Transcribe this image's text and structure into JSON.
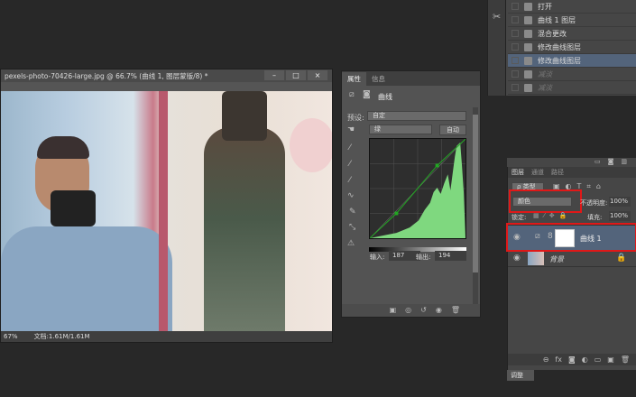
{
  "history": {
    "items": [
      {
        "label": "打开",
        "state": "normal"
      },
      {
        "label": "曲线 1 图层",
        "state": "normal"
      },
      {
        "label": "混合更改",
        "state": "normal"
      },
      {
        "label": "修改曲线图层",
        "state": "normal"
      },
      {
        "label": "修改曲线图层",
        "state": "selected"
      },
      {
        "label": "减淡",
        "state": "dim"
      },
      {
        "label": "减淡",
        "state": "dim"
      }
    ]
  },
  "document": {
    "title": "pexels-photo-70426-large.jpg @ 66.7% (曲线 1, 图层蒙版/8) *",
    "zoom": "67%",
    "doc_size": "文档:1.61M/1.61M",
    "minimize": "–",
    "maximize": "□",
    "close": "×"
  },
  "properties": {
    "tabs": [
      "属性",
      "信息"
    ],
    "title": "曲线",
    "preset_label": "预设:",
    "preset_value": "自定",
    "channel_value": "绿",
    "auto_label": "自动",
    "input_label": "输入:",
    "input_value": "187",
    "output_label": "输出:",
    "output_value": "194",
    "curve_color": "#7fd87f"
  },
  "layers": {
    "tabs": [
      "图层",
      "通道",
      "路径"
    ],
    "filter_label": "ρ 类型",
    "blend_mode": "颜色",
    "opacity_label": "不透明度:",
    "opacity_value": "100%",
    "lock_label": "锁定:",
    "fill_label": "填充:",
    "fill_value": "100%",
    "items": [
      {
        "name": "曲线 1",
        "selected": true
      },
      {
        "name": "背景",
        "locked": true
      }
    ]
  },
  "bottom_tab": "调整"
}
